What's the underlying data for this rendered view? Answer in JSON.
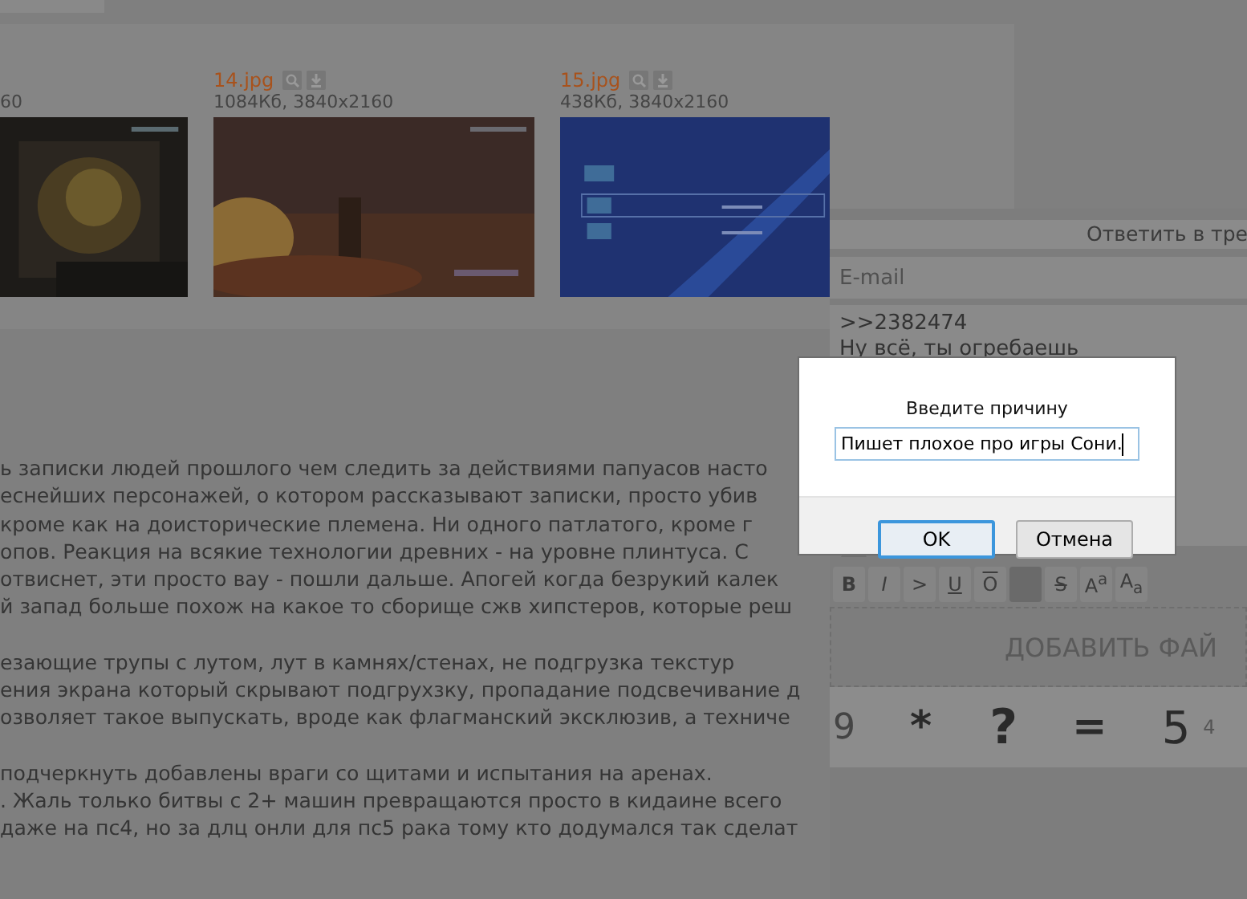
{
  "files": [
    {
      "meta": "60",
      "kind": "picture"
    },
    {
      "name": "14.jpg",
      "meta": "1084Кб, 3840x2160",
      "kind": "picture"
    },
    {
      "name": "15.jpg",
      "meta": "438Кб, 3840x2160",
      "kind": "picture"
    }
  ],
  "post_text": [
    [
      "ь записки людей прошлого чем следить за действиями папуасов насто",
      "еснейших персонажей, о котором рассказывают записки, просто убив",
      "кроме как на доисторические племена. Ни одного патлатого, кроме г",
      "опов. Реакция на всякие технологии древних - на уровне плинтуса. С",
      "отвиснет, эти просто вау - пошли дальше. Апогей когда безрукий калек",
      "й запад больше похож на какое то сборище сжв хипстеров, которые реш"
    ],
    [
      "езающие трупы с лутом, лут в камнях/стенах, не подгрузка текстур",
      "ения экрана который скрывают подгрухзку, пропадание подсвечивание д",
      "озволяет такое выпускать, вроде как флагманский эксклюзив, а техниче"
    ],
    [
      "подчеркнуть добавлены враги со щитами и испытания на аренах.",
      ". Жаль только битвы с 2+ машин превращаются просто в кидаине всего",
      "даже на пс4, но за длц онли для пс5 рака тому кто додумался так сделат"
    ]
  ],
  "reply_form": {
    "title": "Ответить в тре",
    "email": {
      "placeholder": "E-mail"
    },
    "message": [
      ">>2382474",
      "Ну всё, ты огребаешь"
    ],
    "toolbar": [
      {
        "kind": "bold",
        "label": "B"
      },
      {
        "kind": "italic",
        "label": "I"
      },
      {
        "kind": "quote",
        "label": ">"
      },
      {
        "kind": "underline",
        "label": "U"
      },
      {
        "kind": "overline",
        "label": "O"
      },
      {
        "kind": "spoiler"
      },
      {
        "kind": "strike",
        "label": "S"
      },
      {
        "kind": "sup",
        "label": "A$^{a}$"
      },
      {
        "kind": "sub",
        "label": "A$_{a}$"
      }
    ],
    "upload": "ДОБАВИТЬ ФАЙ",
    "captcha": [
      "9",
      "*",
      "?",
      "=",
      "5",
      "4"
    ]
  },
  "dialog": {
    "prompt": "Введите причину",
    "value": "Пишет плохое про игры Сони.",
    "buttons": [
      {
        "label": "OK",
        "focused": true
      },
      {
        "label": "Отмена",
        "focused": false
      }
    ]
  }
}
